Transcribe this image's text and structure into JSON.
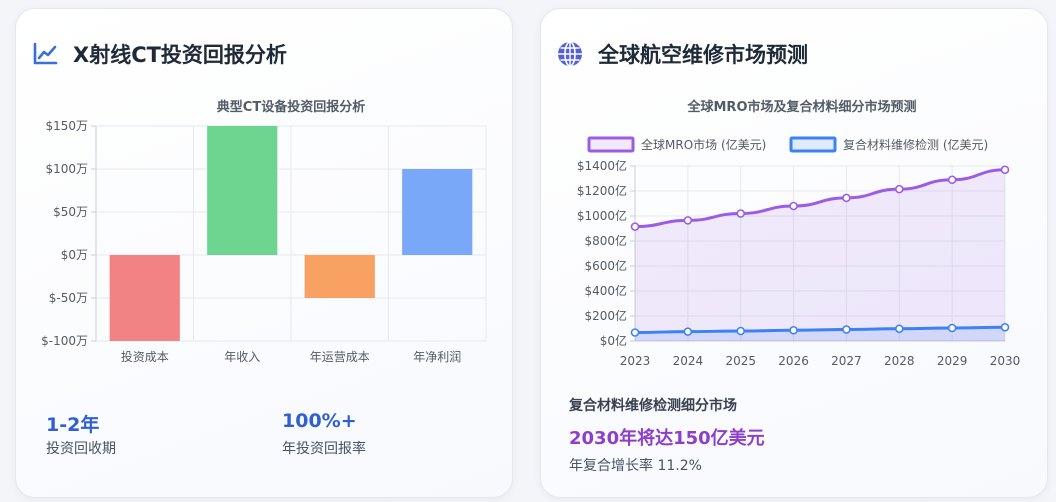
{
  "left": {
    "title": "X射线CT投资回报分析",
    "icon": "line-chart-icon",
    "stats": [
      {
        "value": "1-2年",
        "label": "投资回收期"
      },
      {
        "value": "100%+",
        "label": "年投资回报率"
      }
    ]
  },
  "right": {
    "title": "全球航空维修市场预测",
    "icon": "globe-icon",
    "segment": {
      "title": "复合材料维修检测细分市场",
      "highlight": "2030年将达150亿美元",
      "growth": "年复合增长率 11.2%"
    }
  },
  "colors": {
    "accent_blue": "#2f5fd3",
    "accent_purple": "#8e3fc9",
    "bar_negative": "#f17c7e",
    "bar_positive": "#66d38a",
    "bar_cost": "#f99b5b",
    "bar_net": "#73a3f8",
    "line_mro": "#9b5de5",
    "line_composite": "#3b82f6"
  },
  "chart_data": [
    {
      "type": "bar",
      "title": "典型CT设备投资回报分析",
      "categories": [
        "投资成本",
        "年收入",
        "年运营成本",
        "年净利润"
      ],
      "values": [
        -100,
        150,
        -50,
        100
      ],
      "ylim": [
        -100,
        150
      ],
      "yticks": [
        -100,
        -50,
        0,
        50,
        100,
        150
      ],
      "ytick_labels": [
        "$-100万",
        "$-50万",
        "$0万",
        "$50万",
        "$100万",
        "$150万"
      ],
      "grid": true,
      "legend": "none"
    },
    {
      "type": "line",
      "title": "全球MRO市场及复合材料细分市场预测",
      "x": [
        "2023",
        "2024",
        "2025",
        "2026",
        "2027",
        "2028",
        "2029",
        "2030"
      ],
      "series": [
        {
          "name": "全球MRO市场 (亿美元)",
          "values": [
            915,
            965,
            1020,
            1080,
            1145,
            1215,
            1290,
            1370
          ],
          "fill": true
        },
        {
          "name": "复合材料维修检测 (亿美元)",
          "values": [
            68,
            75,
            80,
            86,
            92,
            98,
            104,
            110
          ],
          "fill": true
        }
      ],
      "ylim": [
        0,
        1400
      ],
      "yticks": [
        0,
        200,
        400,
        600,
        800,
        1000,
        1200,
        1400
      ],
      "ytick_labels": [
        "$0亿",
        "$200亿",
        "$400亿",
        "$600亿",
        "$800亿",
        "$1000亿",
        "$1200亿",
        "$1400亿"
      ],
      "grid": true,
      "legend": "top"
    }
  ]
}
